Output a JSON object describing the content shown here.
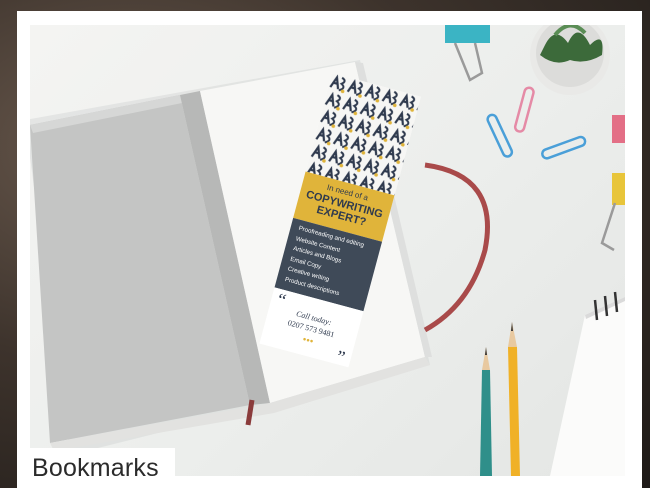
{
  "caption": "Bookmarks",
  "bookmark": {
    "heading_line1": "In need of a",
    "heading_line2": "COPYWRITING",
    "heading_line3": "EXPERT?",
    "services": [
      "Proofreading and editing",
      "Website Content",
      "Articles and Blogs",
      "Email Copy",
      "Creative writing",
      "Product descriptions"
    ],
    "call_label": "Call today:",
    "phone": "0207 573 9481",
    "open_quote": "“",
    "close_quote": "”"
  },
  "colors": {
    "mustard": "#e0b43a",
    "slate": "#3f4a58",
    "navy": "#2f3a4e",
    "strap": "#a94a4a",
    "pencil_teal": "#2f8f8a",
    "pencil_yellow": "#f0b127"
  }
}
